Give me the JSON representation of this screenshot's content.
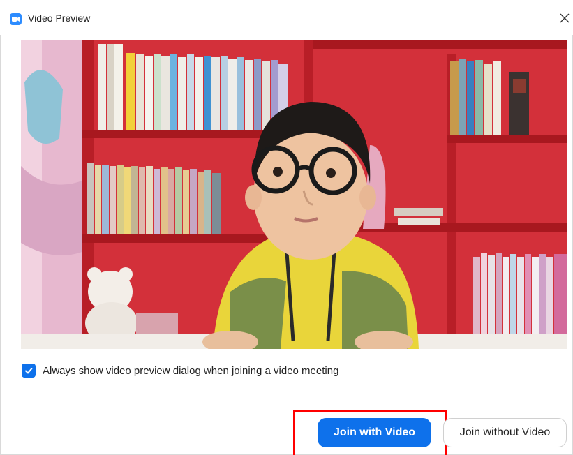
{
  "window": {
    "title": "Video Preview"
  },
  "preview": {
    "description_icon": "camera-preview-image"
  },
  "options": {
    "always_show_label": "Always show video preview dialog when joining a video meeting",
    "always_show_checked": true
  },
  "buttons": {
    "join_with_video": "Join with Video",
    "join_without_video": "Join without Video"
  },
  "colors": {
    "accent": "#0e71eb",
    "highlight": "#ff0000"
  }
}
